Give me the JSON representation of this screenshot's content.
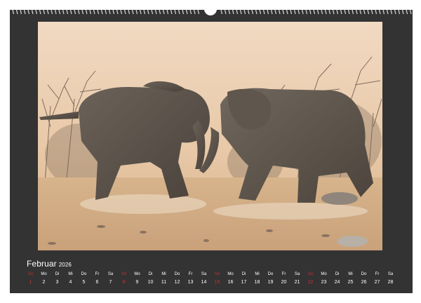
{
  "calendar": {
    "month": "Februar",
    "year": "2026",
    "days": [
      {
        "wd": "So",
        "d": "1",
        "sun": true
      },
      {
        "wd": "Mo",
        "d": "2"
      },
      {
        "wd": "Di",
        "d": "3"
      },
      {
        "wd": "Mi",
        "d": "4"
      },
      {
        "wd": "Do",
        "d": "5"
      },
      {
        "wd": "Fr",
        "d": "6"
      },
      {
        "wd": "Sa",
        "d": "7"
      },
      {
        "wd": "So",
        "d": "8",
        "sun": true
      },
      {
        "wd": "Mo",
        "d": "9"
      },
      {
        "wd": "Di",
        "d": "10"
      },
      {
        "wd": "Mi",
        "d": "11"
      },
      {
        "wd": "Do",
        "d": "12"
      },
      {
        "wd": "Fr",
        "d": "13"
      },
      {
        "wd": "Sa",
        "d": "14"
      },
      {
        "wd": "So",
        "d": "15",
        "sun": true
      },
      {
        "wd": "Mo",
        "d": "16"
      },
      {
        "wd": "Di",
        "d": "17"
      },
      {
        "wd": "Mi",
        "d": "18"
      },
      {
        "wd": "Do",
        "d": "19"
      },
      {
        "wd": "Fr",
        "d": "20"
      },
      {
        "wd": "Sa",
        "d": "21"
      },
      {
        "wd": "So",
        "d": "22",
        "sun": true
      },
      {
        "wd": "Mo",
        "d": "23"
      },
      {
        "wd": "Di",
        "d": "24"
      },
      {
        "wd": "Mi",
        "d": "25"
      },
      {
        "wd": "Do",
        "d": "26"
      },
      {
        "wd": "Fr",
        "d": "27"
      },
      {
        "wd": "Sa",
        "d": "28"
      }
    ]
  },
  "colors": {
    "page_background": "#333333",
    "sunday": "#c8312f",
    "text": "#ffffff"
  }
}
